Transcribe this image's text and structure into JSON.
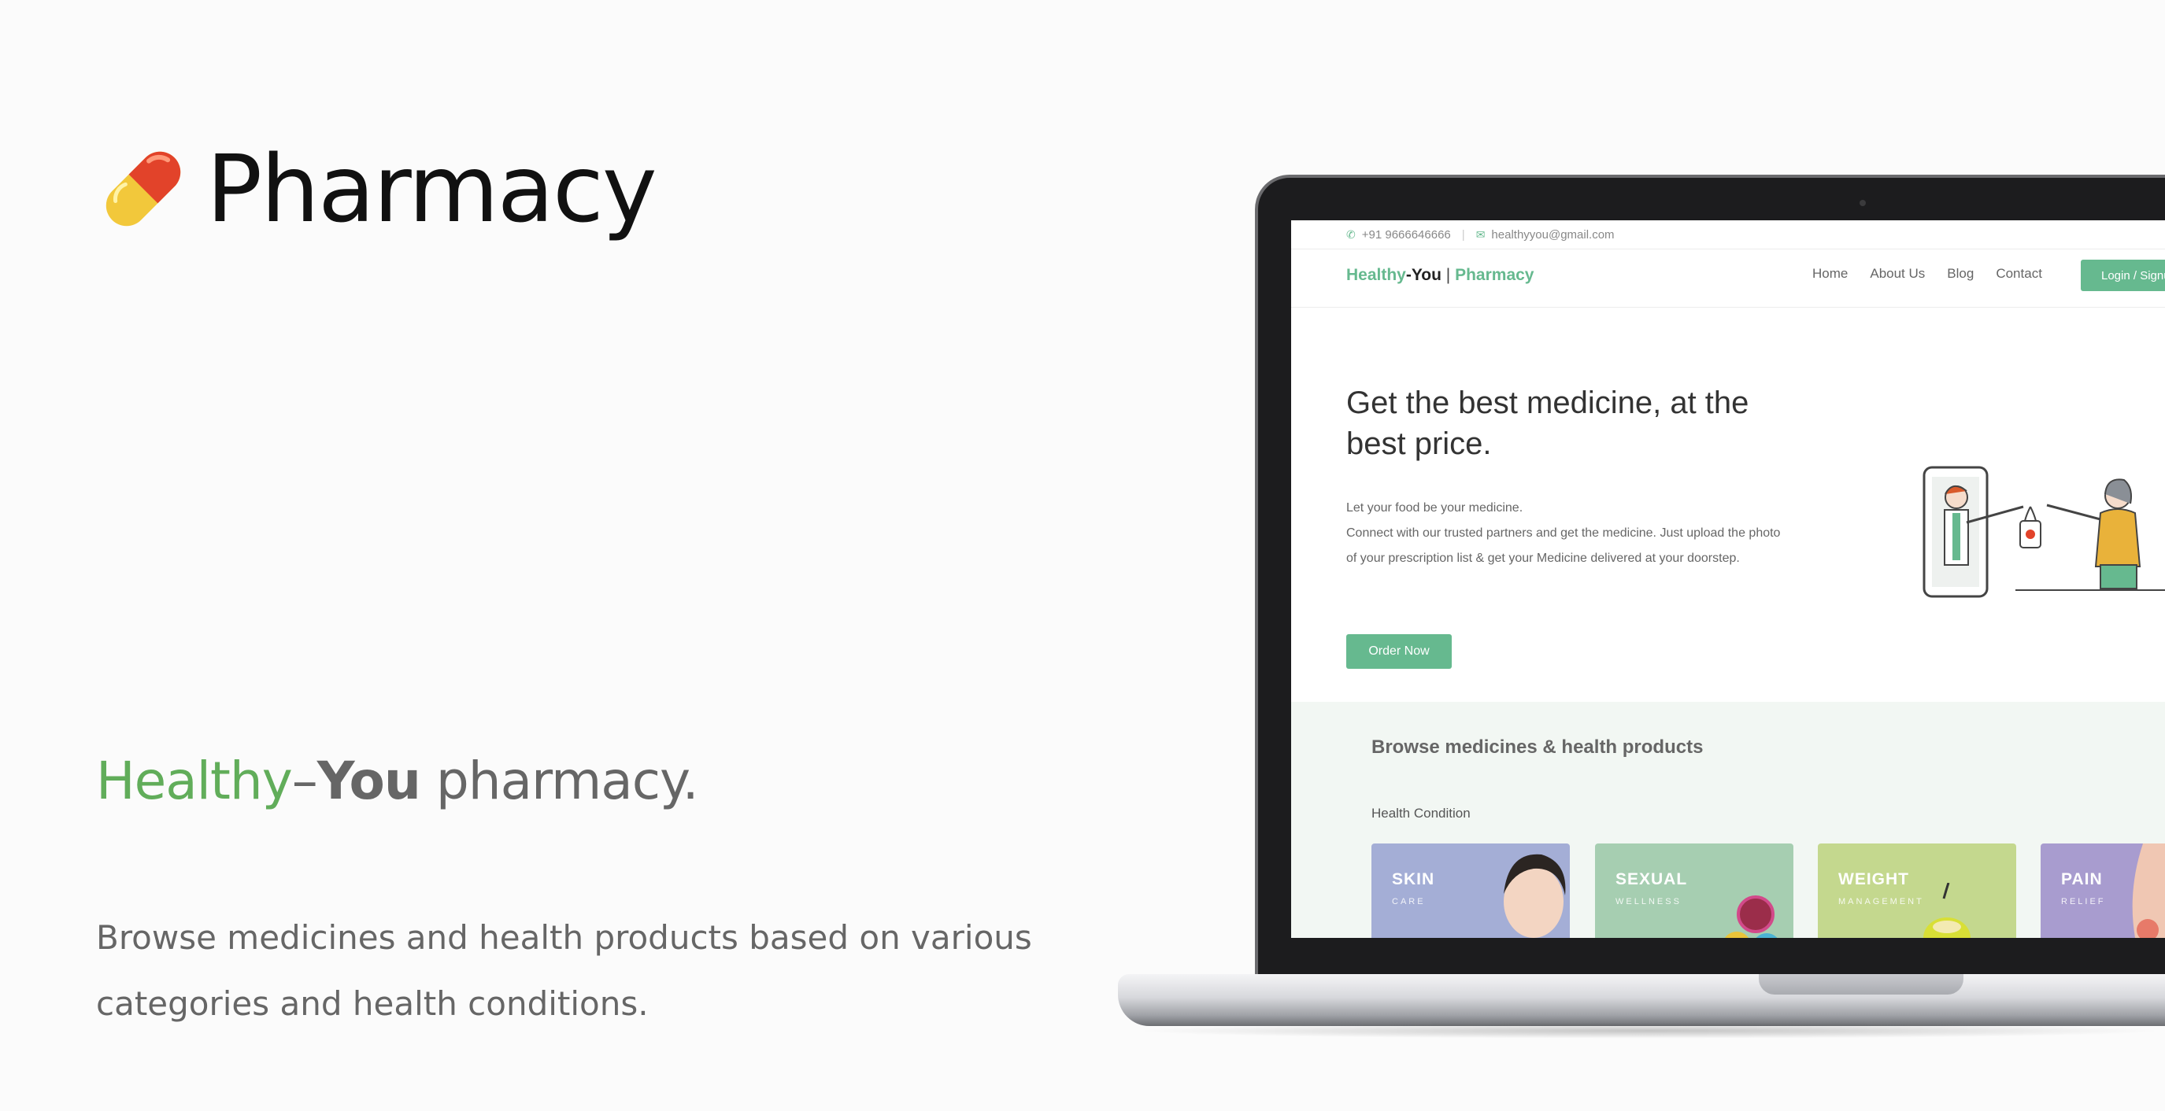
{
  "left": {
    "title": "Pharmacy",
    "pill_icon": "pill-icon",
    "tagline": {
      "healthy": "Healthy",
      "dash": "–",
      "you": "You",
      "rest": " pharmacy."
    },
    "description": "Browse medicines and health products based on various categories and health conditions."
  },
  "screen": {
    "topbar": {
      "phone": "+91 9666646666",
      "email": "healthyyou@gmail.com"
    },
    "logo": {
      "healthy": "Healthy",
      "dash": "-",
      "you": "You",
      "bar": " | ",
      "pharmacy": "Pharmacy"
    },
    "nav": [
      "Home",
      "About Us",
      "Blog",
      "Contact"
    ],
    "login_label": "Login / Signup",
    "hero": {
      "title": "Get the best medicine, at the best price.",
      "line1": "Let your food be your medicine.",
      "line2": "Connect with our trusted partners and get the medicine. Just upload the photo of your prescription list & get your Medicine delivered at your doorstep.",
      "order_label": "Order Now"
    },
    "browse": {
      "title": "Browse medicines & health products",
      "section": "Health Condition",
      "cards": [
        {
          "title": "SKIN",
          "sub": "CARE",
          "color": "#a4aed6"
        },
        {
          "title": "SEXUAL",
          "sub": "WELLNESS",
          "color": "#a6ceb1"
        },
        {
          "title": "WEIGHT",
          "sub": "MANAGEMENT",
          "color": "#c4d88e"
        },
        {
          "title": "PAIN",
          "sub": "RELIEF",
          "color": "#a89ccf"
        }
      ]
    }
  },
  "colors": {
    "brand_green": "#66b98f",
    "tag_green": "#61ad5a"
  }
}
